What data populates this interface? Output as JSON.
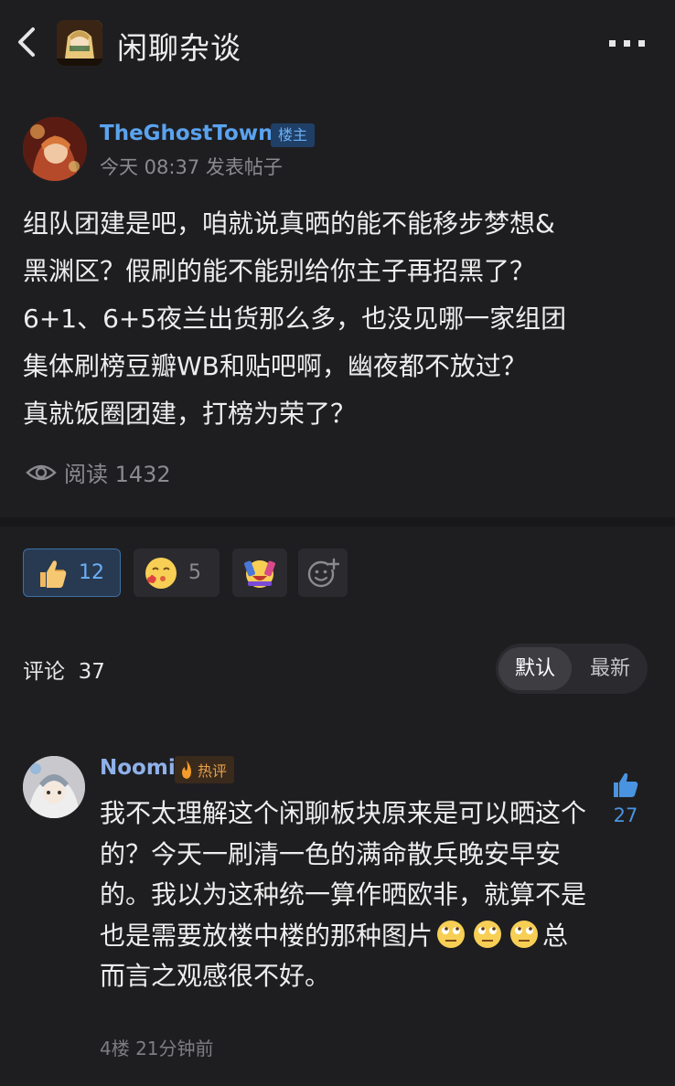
{
  "header": {
    "board_title": "闲聊杂谈",
    "back_icon": "chevron-left-icon",
    "more_icon": "more-dots-icon"
  },
  "post": {
    "author": "TheGhostTown",
    "owner_badge": "楼主",
    "meta": "今天 08:37 发表帖子",
    "body": "组队团建是吧，咱就说真晒的能不能移步梦想&\n黑渊区？假刷的能不能别给你主子再招黑了？\n6+1、6+5夜兰出货那么多，也没见哪一家组团\n集体刷榜豆瓣WB和贴吧啊，幽夜都不放过？\n真就饭圈团建，打榜为荣了？",
    "read_label": "阅读 1432"
  },
  "reactions": [
    {
      "icon": "thumbs-up-emoji-icon",
      "count": "12",
      "active": true
    },
    {
      "icon": "kiss-face-emoji-icon",
      "count": "5",
      "active": false
    },
    {
      "icon": "party-emoji-icon",
      "count": "",
      "active": false
    },
    {
      "icon": "add-reaction-icon",
      "count": "",
      "active": false
    }
  ],
  "comments_section": {
    "header": "评论  37",
    "sort_default": "默认",
    "sort_latest": "最新"
  },
  "comment": {
    "author": "Noomi",
    "hot_badge": "热评",
    "body_part1": "我不太理解这个闲聊板块原来是可以晒这个的？今天一刷清一色的满命散兵晚安早安的。我以为这种统一算作晒欧非，就算不是也是需要放楼中楼的那种图片",
    "body_part2": "总而言之观感很不好。",
    "meta": "4楼 21分钟前",
    "likes": "27"
  },
  "colors": {
    "background": "#1e1e21",
    "accent_blue": "#5aa3ef",
    "hot_orange": "#e8a04a"
  }
}
